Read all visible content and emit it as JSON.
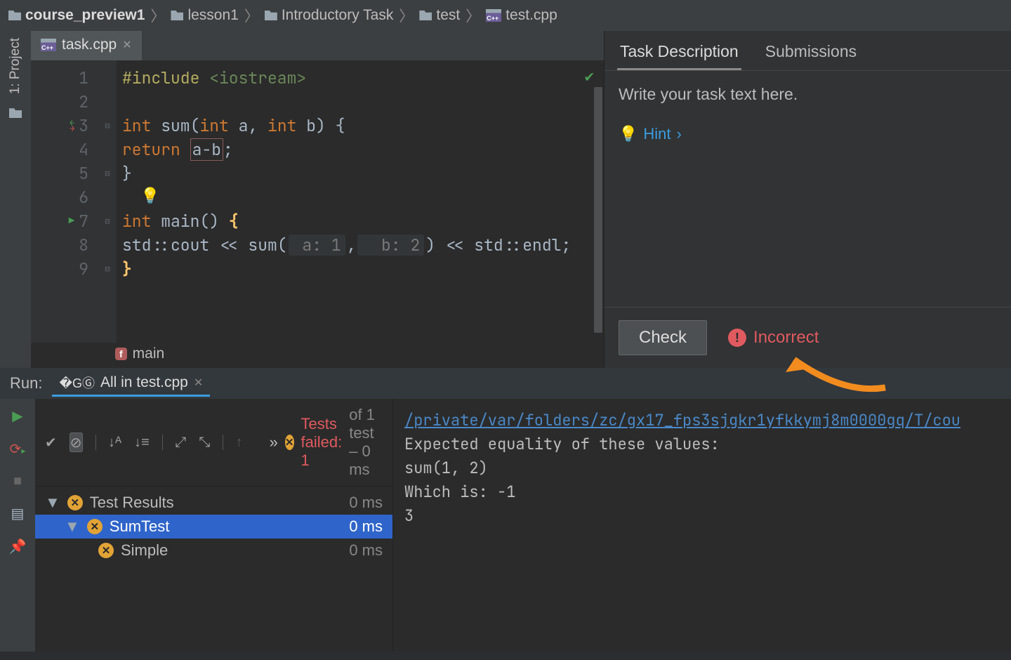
{
  "breadcrumbs": [
    {
      "label": "course_preview1",
      "icon": "folder"
    },
    {
      "label": "lesson1",
      "icon": "folder"
    },
    {
      "label": "Introductory Task",
      "icon": "folder"
    },
    {
      "label": "test",
      "icon": "folder"
    },
    {
      "label": "test.cpp",
      "icon": "cpp"
    }
  ],
  "left_rail": {
    "project": "1: Project"
  },
  "editor": {
    "tab": {
      "filename": "task.cpp"
    },
    "lines": [
      "1",
      "2",
      "3",
      "4",
      "5",
      "6",
      "7",
      "8",
      "9"
    ],
    "code": {
      "l1_pp": "#include ",
      "l1_inc": "<iostream>",
      "l3_kw": "int ",
      "l3_name": "sum(",
      "l3_kw2": "int ",
      "l3_a": "a, ",
      "l3_kw3": "int ",
      "l3_b": "b) {",
      "l4_ret": "return ",
      "l4_expr": "a-b",
      "l4_semi": ";",
      "l5": "}",
      "l7_kw": "int ",
      "l7_name": "main() ",
      "l7_b": "{",
      "l8_pre": "std::cout << sum(",
      "l8_h1": " a: 1",
      "l8_mid": ",",
      "l8_h2": "  b: 2",
      "l8_post": ") << std::endl;",
      "l9": "}"
    },
    "crumb2": "main"
  },
  "task_panel": {
    "tabs": {
      "desc": "Task Description",
      "subs": "Submissions"
    },
    "body": "Write your task text here.",
    "hint": "Hint",
    "check": "Check",
    "status": "Incorrect"
  },
  "run": {
    "label": "Run:",
    "tab": "All in test.cpp",
    "summary": {
      "chevrons": "»",
      "failed": "Tests failed: 1",
      "rest": " of 1 test – 0 ms"
    },
    "tree": {
      "root": {
        "label": "Test Results",
        "time": "0 ms"
      },
      "suite": {
        "label": "SumTest",
        "time": "0 ms"
      },
      "case": {
        "label": "Simple",
        "time": "0 ms"
      }
    },
    "console": {
      "path": "/private/var/folders/zc/gx17_fps3sjgkr1yfkkymj8m0000gq/T/cou",
      "l1": "Expected equality of these values:",
      "l2": "  sum(1, 2)",
      "l3": "    Which is: -1",
      "l4": "  3"
    }
  }
}
